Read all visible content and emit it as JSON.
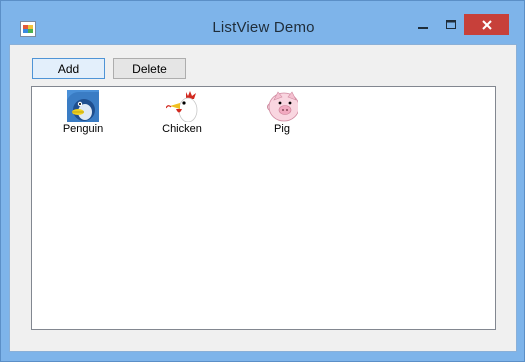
{
  "window": {
    "title": "ListView Demo"
  },
  "toolbar": {
    "add_label": "Add",
    "delete_label": "Delete"
  },
  "listview": {
    "items": [
      {
        "label": "Penguin",
        "icon": "penguin-icon"
      },
      {
        "label": "Chicken",
        "icon": "chicken-icon"
      },
      {
        "label": "Pig",
        "icon": "pig-icon"
      }
    ]
  },
  "colors": {
    "window_frame": "#7eb4ea",
    "close_button": "#c7403a",
    "client_background": "#f0f0f0",
    "add_button_background": "#e3effb",
    "add_button_border": "#4f94d6"
  }
}
